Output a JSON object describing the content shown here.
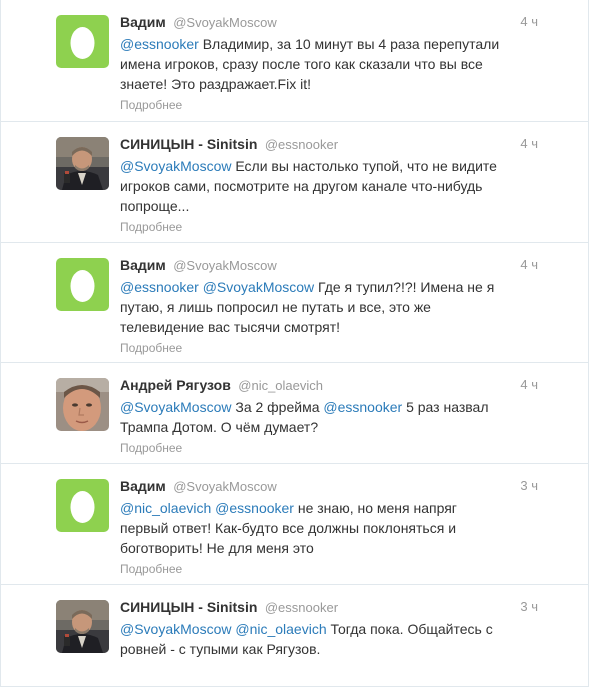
{
  "tweets": [
    {
      "avatar": "egg-avatar",
      "name": "Вадим",
      "handle": "@SvoyakMoscow",
      "time": "4 ч",
      "parts": [
        {
          "mention": "@essnooker"
        },
        {
          "text": " Владимир, за 10 минут вы 4 раза перепутали\nимена игроков, сразу после того как сказали что вы все\nзнаете! Это раздражает.Fix it!"
        }
      ],
      "details": "Подробнее"
    },
    {
      "avatar": "man-photo-avatar",
      "name": "СИНИЦЫН - Sinitsin",
      "handle": "@essnooker",
      "time": "4 ч",
      "parts": [
        {
          "mention": "@SvoyakMoscow"
        },
        {
          "text": " Если вы настолько тупой, что не видите\nигроков сами, посмотрите на другом канале что-нибудь\nпопроще..."
        }
      ],
      "details": "Подробнее"
    },
    {
      "avatar": "egg-avatar",
      "name": "Вадим",
      "handle": "@SvoyakMoscow",
      "time": "4 ч",
      "parts": [
        {
          "mention": "@essnooker"
        },
        {
          "text": " "
        },
        {
          "mention": "@SvoyakMoscow"
        },
        {
          "text": " Где я тупил?!?! Имена не я\nпутаю, я лишь попросил не путать и все, это же\nтелевидение вас тысячи смотрят!"
        }
      ],
      "details": "Подробнее"
    },
    {
      "avatar": "face-photo-avatar",
      "name": "Андрей Рягузов",
      "handle": "@nic_olaevich",
      "time": "4 ч",
      "parts": [
        {
          "mention": "@SvoyakMoscow"
        },
        {
          "text": " За 2 фрейма "
        },
        {
          "mention": "@essnooker"
        },
        {
          "text": " 5 раз назвал\nТрампа Дотом. О чём думает?"
        }
      ],
      "details": "Подробнее"
    },
    {
      "avatar": "egg-avatar",
      "name": "Вадим",
      "handle": "@SvoyakMoscow",
      "time": "3 ч",
      "parts": [
        {
          "mention": "@nic_olaevich"
        },
        {
          "text": " "
        },
        {
          "mention": "@essnooker"
        },
        {
          "text": " не знаю, но меня напряг\nпервый ответ! Как-будто все должны поклоняться и\nбоготворить! Не для меня это"
        }
      ],
      "details": "Подробнее"
    },
    {
      "avatar": "man-photo-avatar",
      "name": "СИНИЦЫН - Sinitsin",
      "handle": "@essnooker",
      "time": "3 ч",
      "parts": [
        {
          "mention": "@SvoyakMoscow"
        },
        {
          "text": " "
        },
        {
          "mention": "@nic_olaevich"
        },
        {
          "text": " Тогда пока. Общайтесь с\nровней - с тупыми как Рягузов."
        }
      ],
      "details": "Подробнее"
    }
  ],
  "colors": {
    "link": "#2b7bb9",
    "muted": "#999999",
    "egg_bg": "#8ed14f",
    "border": "#e1e8ed"
  }
}
